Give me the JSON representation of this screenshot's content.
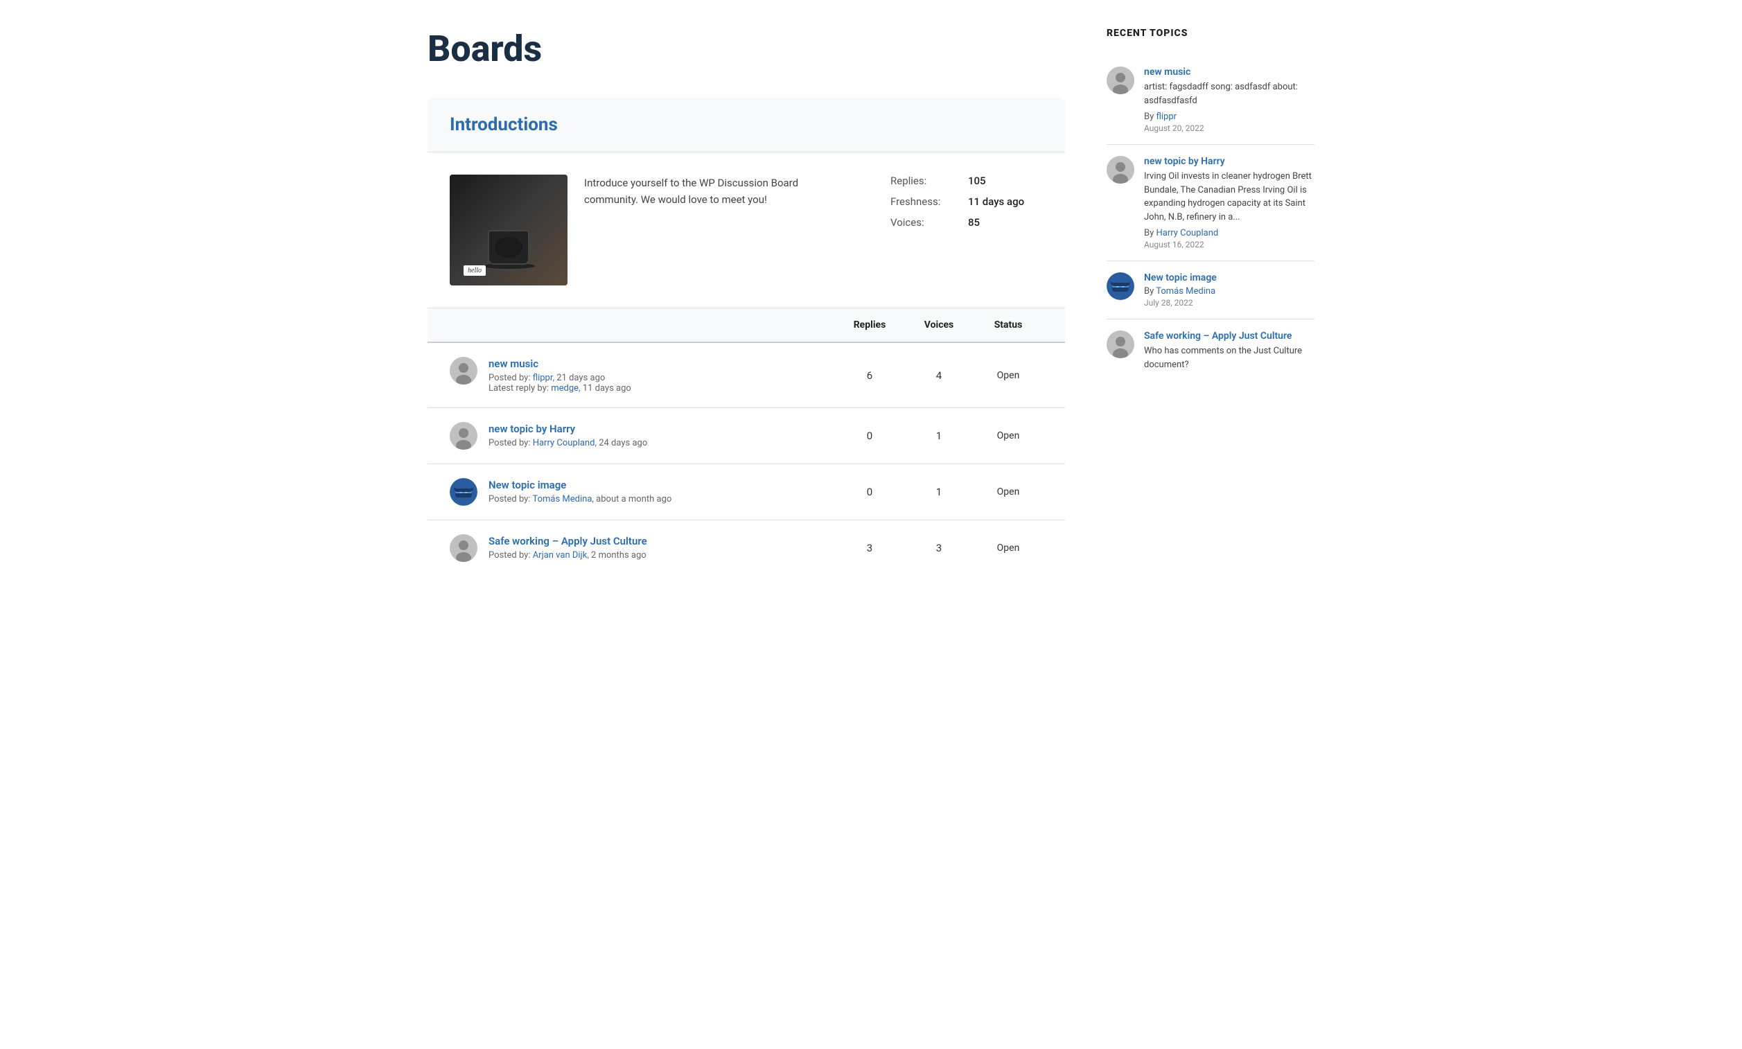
{
  "page": {
    "title": "Boards"
  },
  "board": {
    "name": "Introductions",
    "description": "Introduce yourself to the WP Discussion Board community. We would love to meet you!",
    "stats": {
      "replies_label": "Replies:",
      "replies_value": "105",
      "freshness_label": "Freshness:",
      "freshness_value": "11 days ago",
      "voices_label": "Voices:",
      "voices_value": "85"
    },
    "table_headers": {
      "topic": "",
      "replies": "Replies",
      "voices": "Voices",
      "status": "Status"
    },
    "topics": [
      {
        "id": "1",
        "title": "new music",
        "posted_by": "flippr",
        "posted_ago": "21 days ago",
        "latest_reply_by": "medge",
        "latest_reply_ago": "11 days ago",
        "replies": "6",
        "voices": "4",
        "status": "Open",
        "has_ninja_avatar": false
      },
      {
        "id": "2",
        "title": "new topic by Harry",
        "posted_by": "Harry Coupland",
        "posted_ago": "24 days ago",
        "latest_reply_by": null,
        "latest_reply_ago": null,
        "replies": "0",
        "voices": "1",
        "status": "Open",
        "has_ninja_avatar": false
      },
      {
        "id": "3",
        "title": "New topic image",
        "posted_by": "Tomás Medina",
        "posted_ago": "about a month ago",
        "latest_reply_by": null,
        "latest_reply_ago": null,
        "replies": "0",
        "voices": "1",
        "status": "Open",
        "has_ninja_avatar": true
      },
      {
        "id": "4",
        "title": "Safe working – Apply Just Culture",
        "posted_by": "Arjan van Dijk",
        "posted_ago": "2 months ago",
        "latest_reply_by": null,
        "latest_reply_ago": null,
        "replies": "3",
        "voices": "3",
        "status": "Open",
        "has_ninja_avatar": false
      }
    ]
  },
  "sidebar": {
    "title": "RECENT TOPICS",
    "items": [
      {
        "title": "new music",
        "excerpt": "artist: fagsdadff song: asdfasdf about: asdfasdfasfd",
        "by_label": "By",
        "by": "flippr",
        "date": "August 20, 2022",
        "has_ninja_avatar": false
      },
      {
        "title": "new topic by Harry",
        "excerpt": "Irving Oil invests in cleaner hydrogen Brett Bundale, The Canadian Press Irving Oil is expanding hydrogen capacity at its Saint John, N.B, refinery in a...",
        "by_label": "By",
        "by": "Harry Coupland",
        "date": "August 16, 2022",
        "has_ninja_avatar": false
      },
      {
        "title": "New topic image",
        "excerpt": "",
        "by_label": "By",
        "by": "Tomás Medina",
        "date": "July 28, 2022",
        "has_ninja_avatar": true
      },
      {
        "title": "Safe working – Apply Just Culture",
        "excerpt": "Who has comments on the Just Culture document?",
        "by_label": "By",
        "by": "",
        "date": "",
        "has_ninja_avatar": false
      }
    ]
  }
}
